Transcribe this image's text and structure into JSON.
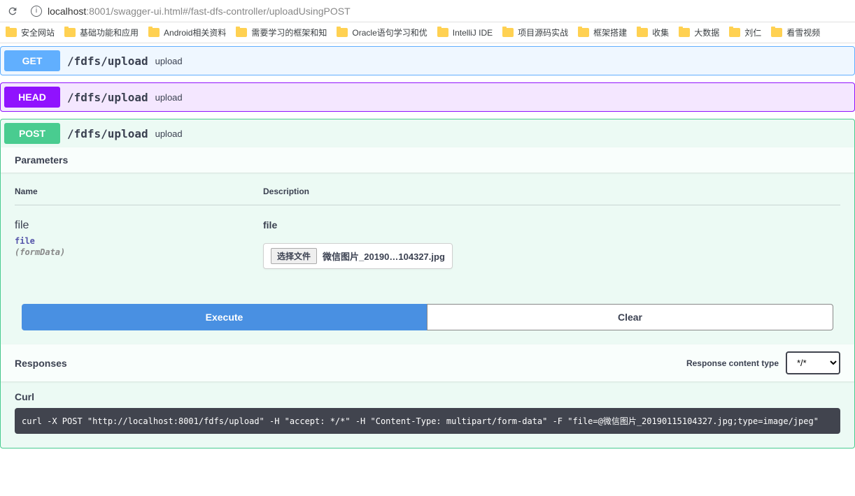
{
  "browser": {
    "url_host": "localhost",
    "url_port": ":8001",
    "url_path": "/swagger-ui.html#/fast-dfs-controller/uploadUsingPOST"
  },
  "bookmarks": [
    "安全网站",
    "基础功能和应用",
    "Android相关资料",
    "需要学习的框架和知",
    "Oracle语句学习和优",
    "IntelliJ IDE",
    "项目源码实战",
    "框架搭建",
    "收集",
    "大数据",
    "刘仁",
    "看雪视频"
  ],
  "ops": {
    "get": {
      "method": "GET",
      "path": "/fdfs/upload",
      "desc": "upload"
    },
    "head": {
      "method": "HEAD",
      "path": "/fdfs/upload",
      "desc": "upload"
    },
    "post": {
      "method": "POST",
      "path": "/fdfs/upload",
      "desc": "upload"
    }
  },
  "parameters": {
    "heading": "Parameters",
    "col_name": "Name",
    "col_desc": "Description",
    "row": {
      "name": "file",
      "type": "file",
      "in": "(formData)",
      "desc": "file",
      "choose_label": "选择文件",
      "file_name": "微信图片_20190…104327.jpg"
    }
  },
  "buttons": {
    "execute": "Execute",
    "clear": "Clear"
  },
  "responses": {
    "heading": "Responses",
    "content_type_label": "Response content type",
    "content_type_value": "*/*"
  },
  "curl": {
    "label": "Curl",
    "command": "curl -X POST \"http://localhost:8001/fdfs/upload\" -H \"accept: */*\" -H \"Content-Type: multipart/form-data\" -F \"file=@微信图片_20190115104327.jpg;type=image/jpeg\""
  }
}
